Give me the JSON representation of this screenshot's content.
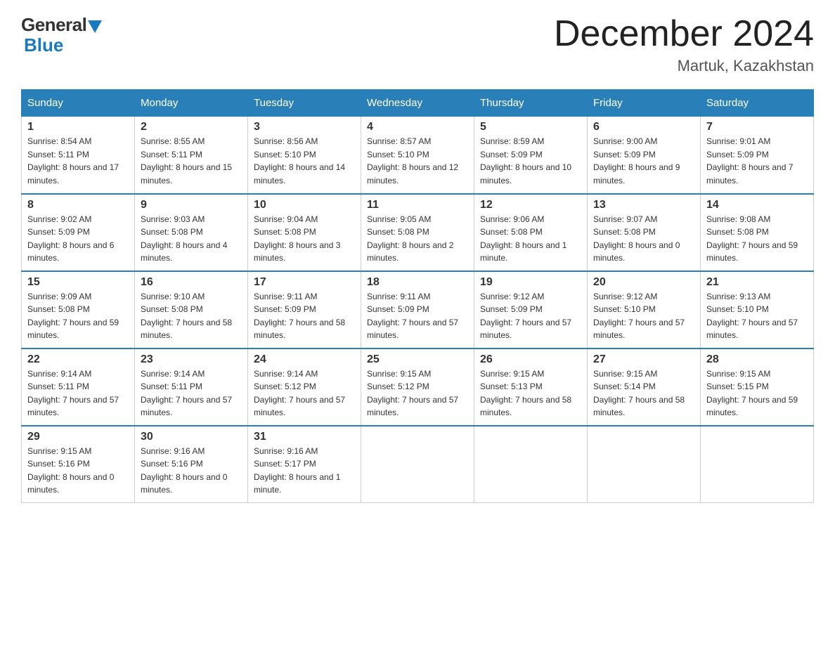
{
  "header": {
    "logo_general": "General",
    "logo_blue": "Blue",
    "month_title": "December 2024",
    "location": "Martuk, Kazakhstan"
  },
  "days_of_week": [
    "Sunday",
    "Monday",
    "Tuesday",
    "Wednesday",
    "Thursday",
    "Friday",
    "Saturday"
  ],
  "weeks": [
    [
      {
        "num": "1",
        "sunrise": "8:54 AM",
        "sunset": "5:11 PM",
        "daylight": "8 hours and 17 minutes."
      },
      {
        "num": "2",
        "sunrise": "8:55 AM",
        "sunset": "5:11 PM",
        "daylight": "8 hours and 15 minutes."
      },
      {
        "num": "3",
        "sunrise": "8:56 AM",
        "sunset": "5:10 PM",
        "daylight": "8 hours and 14 minutes."
      },
      {
        "num": "4",
        "sunrise": "8:57 AM",
        "sunset": "5:10 PM",
        "daylight": "8 hours and 12 minutes."
      },
      {
        "num": "5",
        "sunrise": "8:59 AM",
        "sunset": "5:09 PM",
        "daylight": "8 hours and 10 minutes."
      },
      {
        "num": "6",
        "sunrise": "9:00 AM",
        "sunset": "5:09 PM",
        "daylight": "8 hours and 9 minutes."
      },
      {
        "num": "7",
        "sunrise": "9:01 AM",
        "sunset": "5:09 PM",
        "daylight": "8 hours and 7 minutes."
      }
    ],
    [
      {
        "num": "8",
        "sunrise": "9:02 AM",
        "sunset": "5:09 PM",
        "daylight": "8 hours and 6 minutes."
      },
      {
        "num": "9",
        "sunrise": "9:03 AM",
        "sunset": "5:08 PM",
        "daylight": "8 hours and 4 minutes."
      },
      {
        "num": "10",
        "sunrise": "9:04 AM",
        "sunset": "5:08 PM",
        "daylight": "8 hours and 3 minutes."
      },
      {
        "num": "11",
        "sunrise": "9:05 AM",
        "sunset": "5:08 PM",
        "daylight": "8 hours and 2 minutes."
      },
      {
        "num": "12",
        "sunrise": "9:06 AM",
        "sunset": "5:08 PM",
        "daylight": "8 hours and 1 minute."
      },
      {
        "num": "13",
        "sunrise": "9:07 AM",
        "sunset": "5:08 PM",
        "daylight": "8 hours and 0 minutes."
      },
      {
        "num": "14",
        "sunrise": "9:08 AM",
        "sunset": "5:08 PM",
        "daylight": "7 hours and 59 minutes."
      }
    ],
    [
      {
        "num": "15",
        "sunrise": "9:09 AM",
        "sunset": "5:08 PM",
        "daylight": "7 hours and 59 minutes."
      },
      {
        "num": "16",
        "sunrise": "9:10 AM",
        "sunset": "5:08 PM",
        "daylight": "7 hours and 58 minutes."
      },
      {
        "num": "17",
        "sunrise": "9:11 AM",
        "sunset": "5:09 PM",
        "daylight": "7 hours and 58 minutes."
      },
      {
        "num": "18",
        "sunrise": "9:11 AM",
        "sunset": "5:09 PM",
        "daylight": "7 hours and 57 minutes."
      },
      {
        "num": "19",
        "sunrise": "9:12 AM",
        "sunset": "5:09 PM",
        "daylight": "7 hours and 57 minutes."
      },
      {
        "num": "20",
        "sunrise": "9:12 AM",
        "sunset": "5:10 PM",
        "daylight": "7 hours and 57 minutes."
      },
      {
        "num": "21",
        "sunrise": "9:13 AM",
        "sunset": "5:10 PM",
        "daylight": "7 hours and 57 minutes."
      }
    ],
    [
      {
        "num": "22",
        "sunrise": "9:14 AM",
        "sunset": "5:11 PM",
        "daylight": "7 hours and 57 minutes."
      },
      {
        "num": "23",
        "sunrise": "9:14 AM",
        "sunset": "5:11 PM",
        "daylight": "7 hours and 57 minutes."
      },
      {
        "num": "24",
        "sunrise": "9:14 AM",
        "sunset": "5:12 PM",
        "daylight": "7 hours and 57 minutes."
      },
      {
        "num": "25",
        "sunrise": "9:15 AM",
        "sunset": "5:12 PM",
        "daylight": "7 hours and 57 minutes."
      },
      {
        "num": "26",
        "sunrise": "9:15 AM",
        "sunset": "5:13 PM",
        "daylight": "7 hours and 58 minutes."
      },
      {
        "num": "27",
        "sunrise": "9:15 AM",
        "sunset": "5:14 PM",
        "daylight": "7 hours and 58 minutes."
      },
      {
        "num": "28",
        "sunrise": "9:15 AM",
        "sunset": "5:15 PM",
        "daylight": "7 hours and 59 minutes."
      }
    ],
    [
      {
        "num": "29",
        "sunrise": "9:15 AM",
        "sunset": "5:16 PM",
        "daylight": "8 hours and 0 minutes."
      },
      {
        "num": "30",
        "sunrise": "9:16 AM",
        "sunset": "5:16 PM",
        "daylight": "8 hours and 0 minutes."
      },
      {
        "num": "31",
        "sunrise": "9:16 AM",
        "sunset": "5:17 PM",
        "daylight": "8 hours and 1 minute."
      },
      null,
      null,
      null,
      null
    ]
  ]
}
